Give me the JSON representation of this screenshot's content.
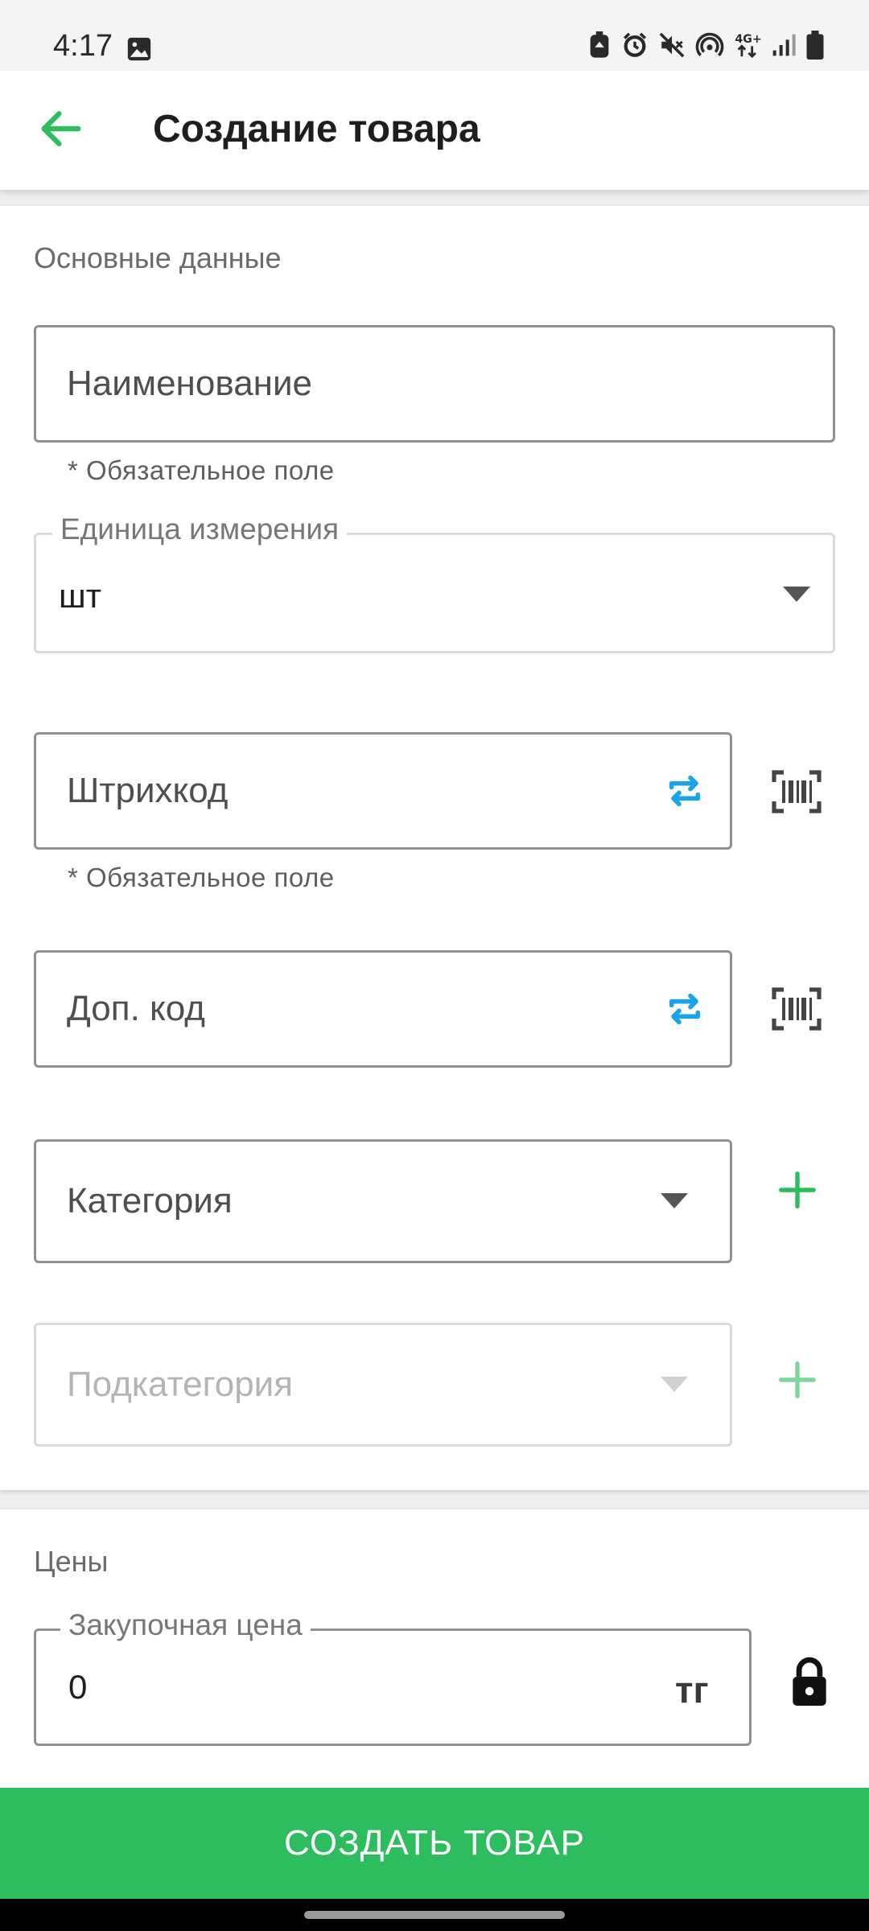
{
  "status_bar": {
    "time": "4:17",
    "icons": [
      "image-icon",
      "recycle-badge-icon",
      "alarm-icon",
      "mute-icon",
      "hotspot-icon",
      "4g-data-icon",
      "signal-icon",
      "battery-icon"
    ],
    "network_label": "4G+"
  },
  "app_bar": {
    "title": "Создание товара",
    "back_icon": "arrow-left-icon",
    "accent_color": "#2dbd5e"
  },
  "main_section": {
    "title": "Основные данные",
    "name_field": {
      "placeholder": "Наименование",
      "helper": "* Обязательное поле"
    },
    "unit_field": {
      "label": "Единица измерения",
      "value": "шт"
    },
    "barcode_field": {
      "placeholder": "Штрихкод",
      "helper": "* Обязательное поле",
      "generate_icon": "repeat-arrows-icon",
      "scan_icon": "barcode-scan-icon"
    },
    "extra_code_field": {
      "placeholder": "Доп. код",
      "generate_icon": "repeat-arrows-icon",
      "scan_icon": "barcode-scan-icon"
    },
    "category_field": {
      "placeholder": "Категория",
      "add_icon": "plus-icon"
    },
    "subcategory_field": {
      "placeholder": "Подкатегория",
      "add_icon": "plus-icon",
      "enabled": false
    }
  },
  "prices_section": {
    "title": "Цены",
    "purchase_price": {
      "label": "Закупочная цена",
      "value": "0",
      "currency": "тг",
      "lock_icon": "lock-icon"
    }
  },
  "submit_button": {
    "label": "СОЗДАТЬ ТОВАР",
    "color": "#2dbd5e"
  },
  "colors": {
    "repeat_icon": "#1aa3e8",
    "plus_icon": "#2dbd5e"
  }
}
